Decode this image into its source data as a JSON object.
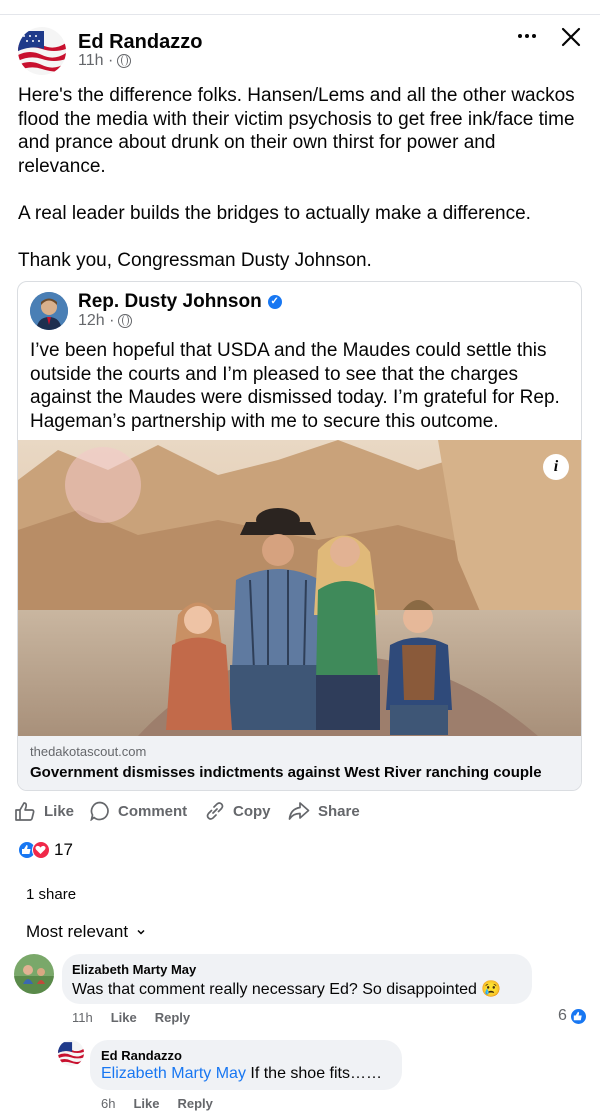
{
  "post": {
    "author": "Ed Randazzo",
    "time": "11h ·",
    "text": "Here's the difference folks. Hansen/Lems and all the other wackos flood the media with their victim psychosis to get free ink/face time and prance about drunk on their own thirst for power and relevance.\n\nA real leader builds the bridges to actually make a difference.\n\nThank you, Congressman Dusty Johnson."
  },
  "shared": {
    "author": "Rep. Dusty Johnson",
    "time": "12h ·",
    "text": "I’ve been hopeful that USDA and the Maudes could settle this outside the courts and I’m pleased to see that the charges against the Maudes were dismissed today. I’m grateful for Rep. Hageman’s partnership with me to secure this outcome.",
    "info_label": "i",
    "link_domain": "thedakotascout.com",
    "link_title": "Government dismisses indictments against West River ranching couple"
  },
  "actions": {
    "like": "Like",
    "comment": "Comment",
    "copy": "Copy",
    "share": "Share"
  },
  "reactions": {
    "count": "17"
  },
  "shares": "1 share",
  "sort": "Most relevant",
  "comments": [
    {
      "author": "Elizabeth Marty May",
      "text": "Was that comment really necessary Ed? So disappointed 😢",
      "time": "11h",
      "like": "Like",
      "reply": "Reply",
      "reaction_count": "6"
    },
    {
      "author": "Ed Randazzo",
      "mention": "Elizabeth Marty May",
      "text": " If the shoe fits……",
      "time": "6h",
      "like": "Like",
      "reply": "Reply"
    }
  ],
  "colors": {
    "accent": "#1877f2",
    "love": "#f02849",
    "secondary_text": "#65676b",
    "bubble": "#f0f2f5"
  },
  "icons": [
    "flag-avatar",
    "globe-icon",
    "more-icon",
    "close-icon",
    "verified-icon",
    "info-icon",
    "like-icon",
    "comment-icon",
    "copy-icon",
    "share-icon",
    "chevron-down-icon"
  ]
}
